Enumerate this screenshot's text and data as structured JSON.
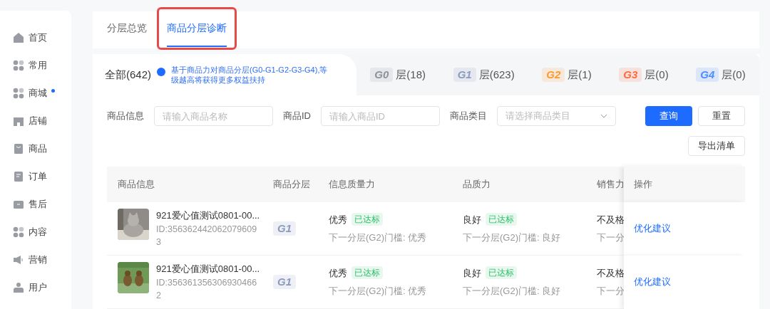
{
  "sidebar": {
    "items": [
      {
        "label": "首页",
        "dot": false
      },
      {
        "label": "常用",
        "dot": false
      },
      {
        "label": "商城",
        "dot": true
      },
      {
        "label": "店铺",
        "dot": false
      },
      {
        "label": "商品",
        "dot": false
      },
      {
        "label": "订单",
        "dot": false
      },
      {
        "label": "售后",
        "dot": false
      },
      {
        "label": "内容",
        "dot": false
      },
      {
        "label": "营销",
        "dot": false
      },
      {
        "label": "用户",
        "dot": false
      }
    ]
  },
  "tabs": [
    {
      "label": "分层总览",
      "selected": false
    },
    {
      "label": "商品分层诊断",
      "selected": true
    }
  ],
  "tiers": {
    "all": {
      "label": "全部(642)",
      "selected": true
    },
    "info": "基于商品力对商品分层(G0-G1-G2-G3-G4),等级越高将获得更多权益扶持",
    "items": [
      {
        "badge": "G0",
        "label": "层(18)",
        "color": "#8e9199",
        "selected": false
      },
      {
        "badge": "G1",
        "label": "层(623)",
        "color": "#8a9bbd",
        "selected": false
      },
      {
        "badge": "G2",
        "label": "层(1)",
        "color": "#ff9a2e",
        "selected": false
      },
      {
        "badge": "G3",
        "label": "层(0)",
        "color": "#ff6a3d",
        "selected": false
      },
      {
        "badge": "G4",
        "label": "层(0)",
        "color": "#4a8dff",
        "selected": false
      }
    ]
  },
  "filters": [
    {
      "kind": "input",
      "label": "商品信息",
      "placeholder": "请输入商品名称"
    },
    {
      "kind": "input",
      "label": "商品ID",
      "placeholder": "请输入商品ID"
    },
    {
      "kind": "select",
      "label": "商品类目",
      "placeholder": "请选择商品类目"
    }
  ],
  "buttons": {
    "query": "查询",
    "reset": "重置",
    "export": "导出清单"
  },
  "table": {
    "columns": [
      "商品信息",
      "商品分层",
      "信息质量力",
      "品质力",
      "销售力",
      "操作"
    ],
    "rows": [
      {
        "name": "921爱心值测试0801-00...",
        "id": "ID:356362442062079609\n3",
        "tier": "G1",
        "info_quality": {
          "value": "优秀",
          "tag": "已达标",
          "next": "下一分层(G2)门槛: 优秀"
        },
        "quality": {
          "value": "良好",
          "tag": "已达标",
          "next": "下一分层(G2)门槛: 良好"
        },
        "sales": {
          "value": "不及格",
          "next": "下一分"
        },
        "action": "优化建议"
      },
      {
        "name": "921爱心值测试0801-00...",
        "id": "ID:356361356306930466\n2",
        "tier": "G1",
        "info_quality": {
          "value": "优秀",
          "tag": "已达标",
          "next": "下一分层(G2)门槛: 优秀"
        },
        "quality": {
          "value": "良好",
          "tag": "已达标",
          "next": "下一分层(G2)门槛: 良好"
        },
        "sales": {
          "value": "不及格",
          "next": "下一分"
        },
        "action": "优化建议"
      }
    ]
  }
}
